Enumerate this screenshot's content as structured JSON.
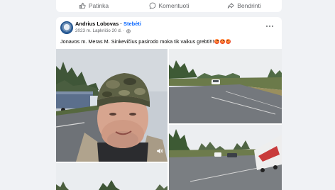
{
  "actions": {
    "like": "Patinka",
    "comment": "Komentuoti",
    "share": "Bendrinti"
  },
  "post": {
    "author": "Andrius Lobovas",
    "separator": " · ",
    "follow_label": "Stebėti",
    "date": "2023 m. Lapkričio 20 d.",
    "privacy_sep": "·",
    "text": "Jonavos m. Meras M. Sinkevičius pasirodo moka tik vaikus grebti!!!",
    "emoji_count": 3
  },
  "icons": {
    "like": "thumbs-up-icon",
    "comment": "comment-bubble-icon",
    "share": "share-arrow-icon",
    "privacy": "globe-icon",
    "more": "more-options-icon",
    "sound": "speaker-icon"
  },
  "colors": {
    "follow": "#0866ff",
    "background": "#f0f2f5",
    "secondary_text": "#65676b"
  }
}
